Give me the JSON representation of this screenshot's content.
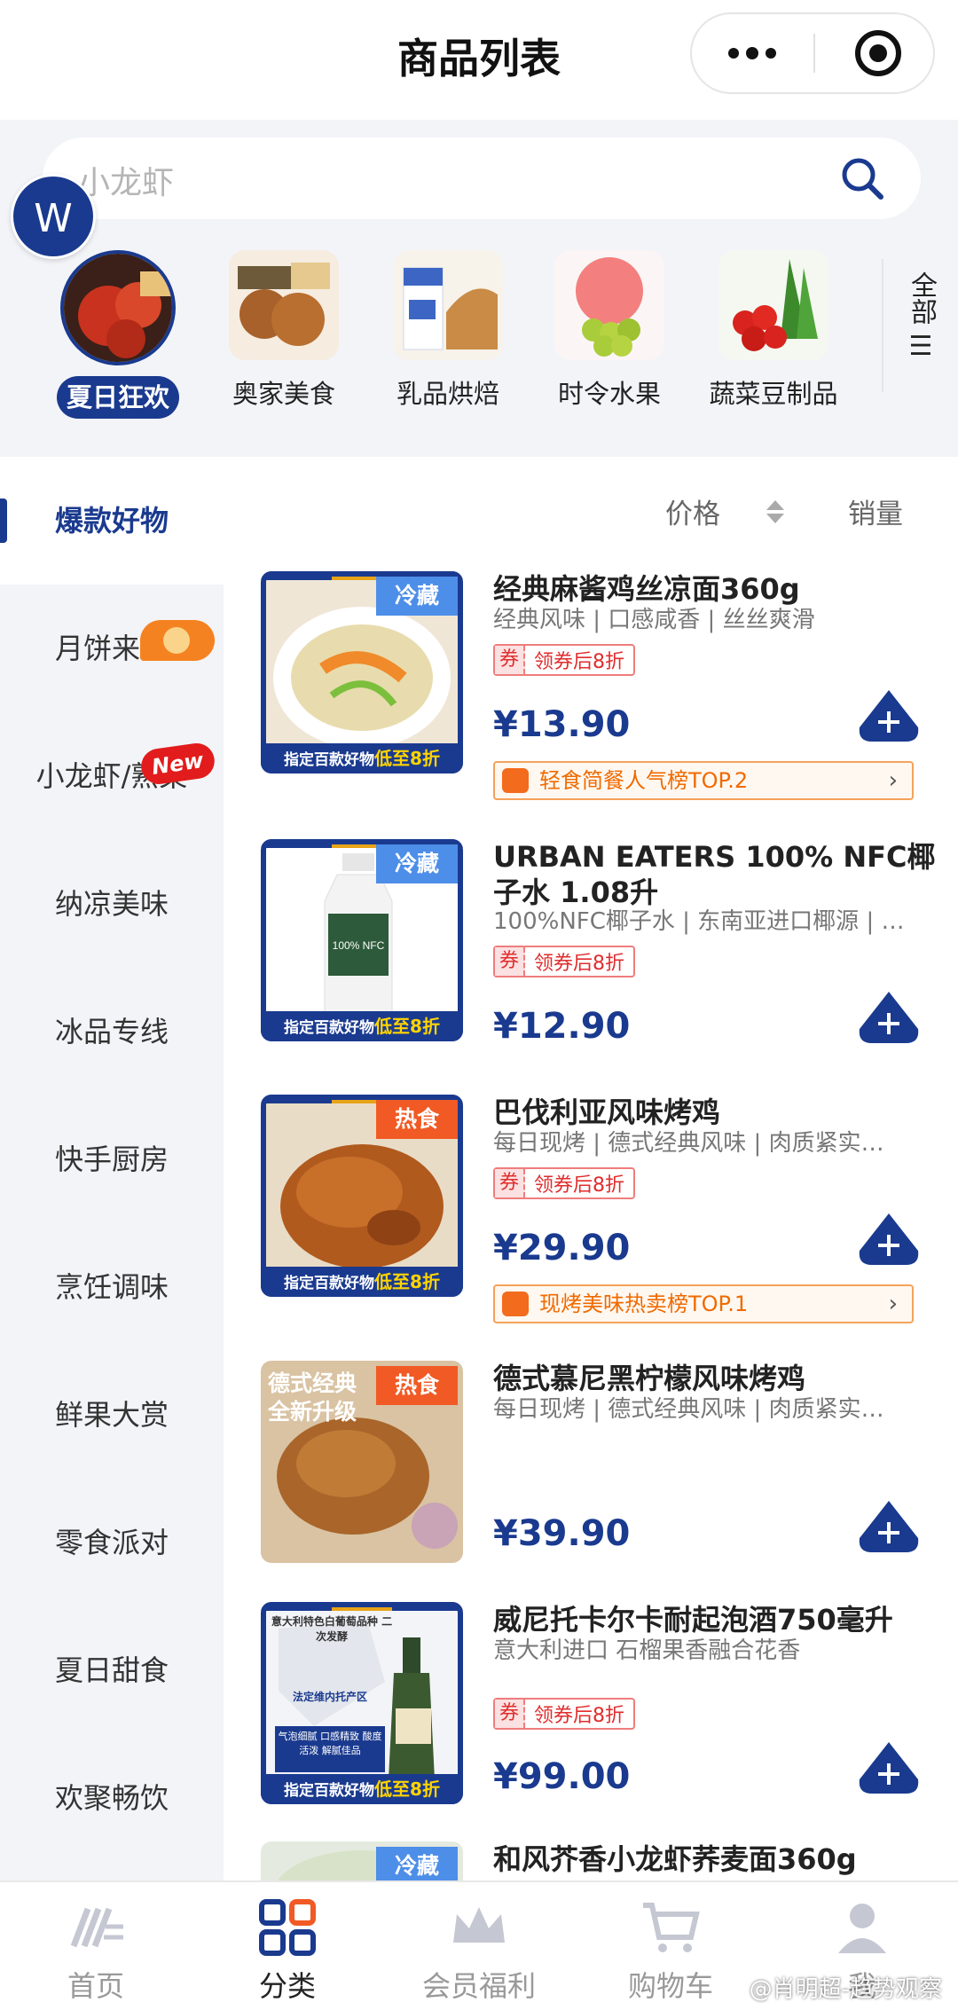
{
  "header": {
    "title": "商品列表"
  },
  "search": {
    "placeholder": "小龙虾"
  },
  "avatar": {
    "letter": "W"
  },
  "categories": [
    {
      "label": "夏日狂欢",
      "active": true
    },
    {
      "label": "奥家美食"
    },
    {
      "label": "乳品烘焙"
    },
    {
      "label": "时令水果"
    },
    {
      "label": "蔬菜豆制品"
    }
  ],
  "all_categories_label": "全部",
  "sidebar": {
    "items": [
      {
        "label": "爆款好物",
        "active": true
      },
      {
        "label": "月饼来了"
      },
      {
        "label": "小龙虾/熟菜",
        "badge": "New"
      },
      {
        "label": "纳凉美味"
      },
      {
        "label": "冰品专线"
      },
      {
        "label": "快手厨房"
      },
      {
        "label": "烹饪调味"
      },
      {
        "label": "鲜果大赏"
      },
      {
        "label": "零食派对"
      },
      {
        "label": "夏日甜食"
      },
      {
        "label": "欢聚畅饮"
      }
    ]
  },
  "sort": {
    "price_label": "价格",
    "sales_label": "销量"
  },
  "promo_strip": {
    "prefix": "指定百款好物",
    "highlight": "低至8折"
  },
  "products": [
    {
      "name": "经典麻酱鸡丝凉面360g",
      "desc": "经典风味 | 口感咸香 | 丝丝爽滑",
      "tag": "冷藏",
      "coupon_mark": "券",
      "coupon_text": "领券后8折",
      "price": "¥13.90",
      "rank": "轻食简餐人气榜TOP.2"
    },
    {
      "name": "URBAN EATERS 100% NFC椰子水 1.08升",
      "desc": "100%NFC椰子水 | 东南亚进口椰源 | …",
      "tag": "冷藏",
      "image_label": "100% NFC",
      "coupon_mark": "券",
      "coupon_text": "领券后8折",
      "price": "¥12.90"
    },
    {
      "name": "巴伐利亚风味烤鸡",
      "desc": "每日现烤 | 德式经典风味 | 肉质紧实…",
      "tag": "热食",
      "coupon_mark": "券",
      "coupon_text": "领券后8折",
      "price": "¥29.90",
      "rank": "现烤美味热卖榜TOP.1"
    },
    {
      "name": "德式慕尼黑柠檬风味烤鸡",
      "desc": "每日现烤 | 德式经典风味 | 肉质紧实…",
      "tag": "热食",
      "image_overlay": "德式经典 全新升级",
      "price": "¥39.90"
    },
    {
      "name": "威尼托卡尔卡耐起泡酒750毫升",
      "desc": "意大利进口 石榴果香融合花香",
      "image_text_1": "意大利特色白葡萄品种 二次发酵",
      "image_text_2": "法定维内托产区",
      "image_text_3": "气泡细腻 口感精致 酸度活泼 解腻佳品",
      "coupon_mark": "券",
      "coupon_text": "领券后8折",
      "price": "¥99.00"
    },
    {
      "name": "和风芥香小龙虾荞麦面360g",
      "tag": "冷藏"
    }
  ],
  "tabbar": [
    {
      "label": "首页"
    },
    {
      "label": "分类",
      "active": true
    },
    {
      "label": "会员福利"
    },
    {
      "label": "购物车"
    },
    {
      "label": "我"
    }
  ],
  "watermark": "@肖明超-趋势观察",
  "colors": {
    "brand": "#1a3a8f",
    "price": "#1a3a8f",
    "hot_tag": "#f15a24",
    "cold_tag": "#4d8ee8",
    "coupon": "#e02d2d",
    "rank": "#f06a00"
  }
}
